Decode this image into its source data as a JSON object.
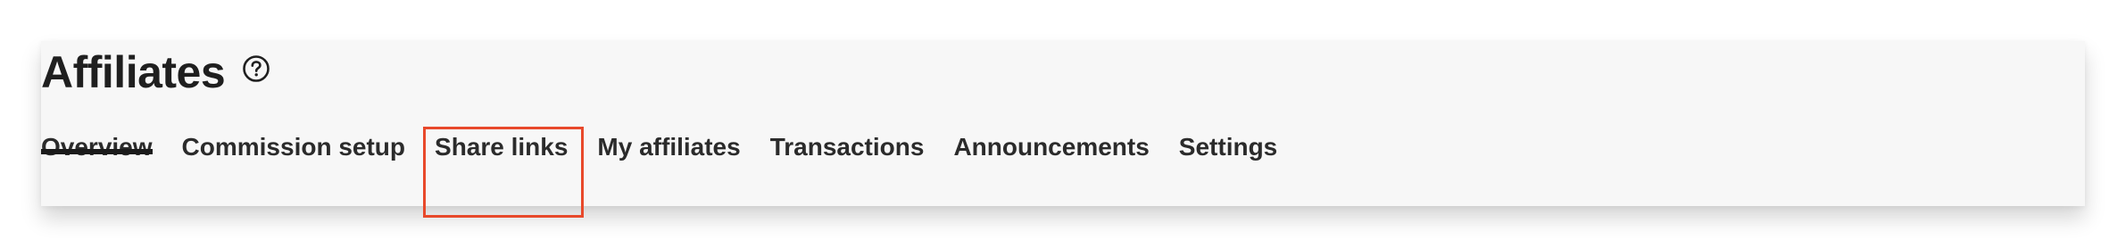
{
  "header": {
    "title": "Affiliates",
    "help_icon": "help-circle-icon"
  },
  "tabs": [
    {
      "label": "Overview",
      "active": true
    },
    {
      "label": "Commission setup",
      "active": false
    },
    {
      "label": "Share links",
      "active": false,
      "highlighted": true
    },
    {
      "label": "My affiliates",
      "active": false
    },
    {
      "label": "Transactions",
      "active": false
    },
    {
      "label": "Announcements",
      "active": false
    },
    {
      "label": "Settings",
      "active": false
    }
  ],
  "colors": {
    "highlight": "#e8492b",
    "active_underline": "#1b1b1b",
    "panel_bg": "#f7f7f7"
  }
}
